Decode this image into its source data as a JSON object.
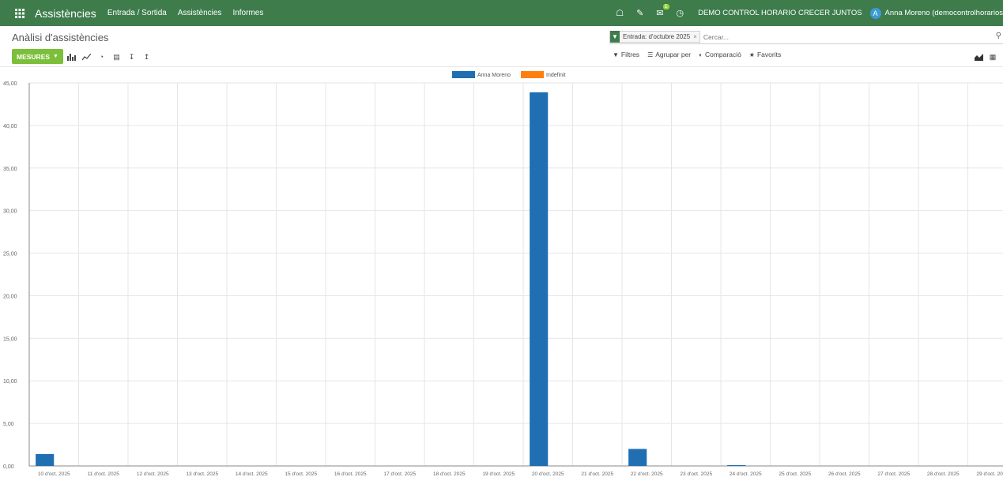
{
  "topbar": {
    "app_title": "Assistències",
    "menu": [
      "Entrada / Sortida",
      "Assistències",
      "Informes"
    ],
    "messages_badge": "1",
    "company": "DEMO CONTROL HORARIO CRECER JUNTOS",
    "avatar_letter": "A",
    "user": "Anna Moreno (democontrolhorarios"
  },
  "control_panel": {
    "breadcrumb": "Anàlisi d'assistències",
    "search_facet": "Entrada: d'octubre 2025",
    "facet_remove": "×",
    "search_placeholder": "Cercar...",
    "measures_label": "MESURES",
    "filters_label": "Filtres",
    "groupby_label": "Agrupar per",
    "comparison_label": "Comparació",
    "favorites_label": "Favorits"
  },
  "colors": {
    "topbar": "#3e7c4c",
    "accent": "#7cbf3a",
    "series_blue": "#1f6fb2",
    "series_orange": "#ff7f0e"
  },
  "chart_data": {
    "type": "bar",
    "legend_placement": "top-center",
    "grid": true,
    "ylim": [
      0,
      45
    ],
    "y_ticks": [
      "0,00",
      "5,00",
      "10,00",
      "15,00",
      "20,00",
      "25,00",
      "30,00",
      "35,00",
      "40,00",
      "45,00"
    ],
    "categories": [
      "10 d'oct. 2025",
      "11 d'oct. 2025",
      "12 d'oct. 2025",
      "13 d'oct. 2025",
      "14 d'oct. 2025",
      "15 d'oct. 2025",
      "16 d'oct. 2025",
      "17 d'oct. 2025",
      "18 d'oct. 2025",
      "19 d'oct. 2025",
      "20 d'oct. 2025",
      "21 d'oct. 2025",
      "22 d'oct. 2025",
      "23 d'oct. 2025",
      "24 d'oct. 2025",
      "25 d'oct. 2025",
      "26 d'oct. 2025",
      "27 d'oct. 2025",
      "28 d'oct. 2025",
      "29 d'oct. 2025"
    ],
    "series": [
      {
        "name": "Anna Moreno",
        "color": "#1f6fb2",
        "values": [
          1.4,
          0,
          0,
          0,
          0,
          0,
          0,
          0,
          0,
          0,
          43.9,
          0,
          2.0,
          0,
          0.1,
          0,
          0,
          0,
          0,
          0
        ]
      },
      {
        "name": "Indefinit",
        "color": "#ff7f0e",
        "values": [
          0,
          0,
          0,
          0,
          0,
          0,
          0,
          0,
          0,
          0,
          0,
          0,
          0,
          0,
          0,
          0,
          0,
          0,
          0,
          0
        ]
      }
    ]
  }
}
